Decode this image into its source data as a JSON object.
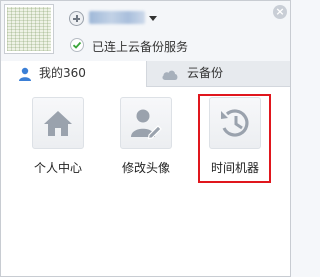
{
  "header": {
    "status_text": "已连上云备份服务",
    "icons": [
      "avatar",
      "add-icon",
      "chevron-down-icon",
      "close-icon",
      "check-icon"
    ]
  },
  "tabs": [
    {
      "label": "我的360",
      "icon": "user-icon",
      "active": true
    },
    {
      "label": "云备份",
      "icon": "cloud-icon",
      "active": false
    }
  ],
  "tiles": [
    {
      "label": "个人中心",
      "icon": "home-icon"
    },
    {
      "label": "修改头像",
      "icon": "edit-avatar-icon"
    },
    {
      "label": "时间机器",
      "icon": "time-machine-icon",
      "highlighted": true
    }
  ],
  "colors": {
    "accent": "#3b7fd6",
    "icon_gray": "#9aa2ad",
    "highlight": "#e0161d",
    "check": "#3aa53a"
  }
}
